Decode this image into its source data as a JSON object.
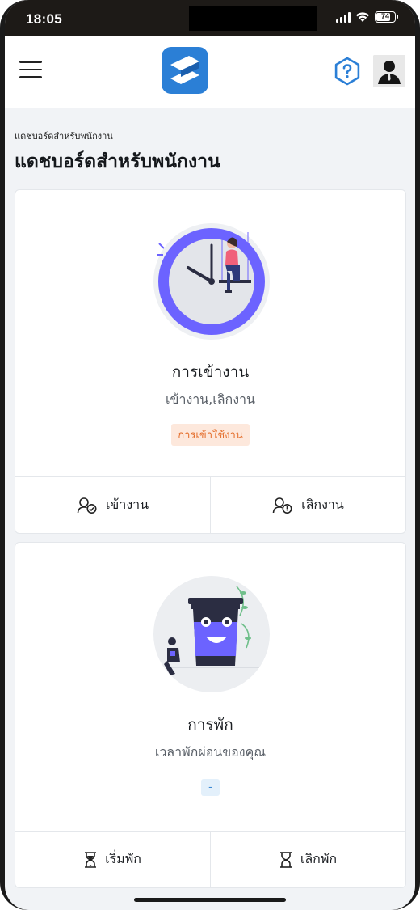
{
  "status": {
    "time": "18:05",
    "battery": "74"
  },
  "header": {
    "menu_icon": "hamburger-menu-icon",
    "logo_icon": "app-logo-icon",
    "help_icon": "help-icon",
    "avatar_icon": "user-avatar-icon"
  },
  "page": {
    "breadcrumb": "แดชบอร์ดสำหรับพนักงาน",
    "title": "แดชบอร์ดสำหรับพนักงาน"
  },
  "attendance_card": {
    "illustration": "clock-illustration",
    "title": "การเข้างาน",
    "subtitle": "เข้างาน,เลิกงาน",
    "badge": "การเข้าใช้งาน",
    "check_in_label": "เข้างาน",
    "check_out_label": "เลิกงาน"
  },
  "break_card": {
    "illustration": "coffee-break-illustration",
    "title": "การพัก",
    "subtitle": "เวลาพักผ่อนของคุณ",
    "badge": "-",
    "start_label": "เริ่มพัก",
    "end_label": "เลิกพัก"
  },
  "colors": {
    "accent_purple": "#6c63ff",
    "brand_blue": "#2b7fd6",
    "badge_orange": "#e46d2a"
  }
}
